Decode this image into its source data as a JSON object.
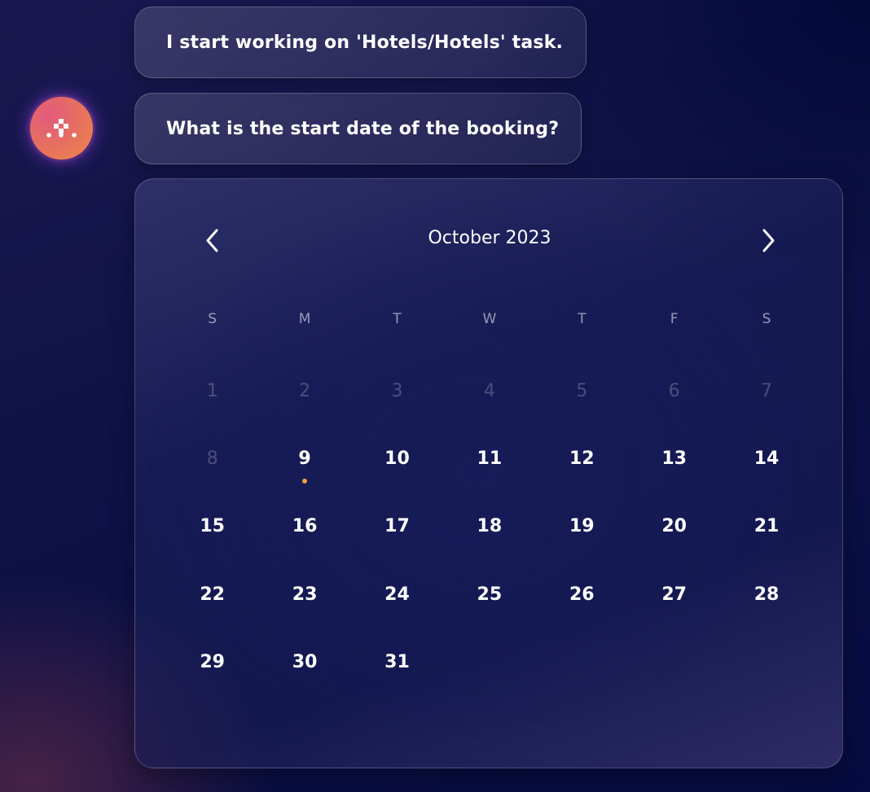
{
  "messages": [
    {
      "text": "I start working on 'Hotels/Hotels' task."
    },
    {
      "text": "What is the start date of the booking?"
    }
  ],
  "avatar": {
    "icon": "assistant-logo-icon",
    "colors": [
      "#e25a7d",
      "#ee8a48"
    ]
  },
  "calendar": {
    "month_label": "October 2023",
    "prev_icon": "chevron-left-icon",
    "next_icon": "chevron-right-icon",
    "weekdays": [
      "S",
      "M",
      "T",
      "W",
      "T",
      "F",
      "S"
    ],
    "today": 9,
    "today_marker_color": "#f0a040",
    "days": [
      {
        "label": "1",
        "enabled": false
      },
      {
        "label": "2",
        "enabled": false
      },
      {
        "label": "3",
        "enabled": false
      },
      {
        "label": "4",
        "enabled": false
      },
      {
        "label": "5",
        "enabled": false
      },
      {
        "label": "6",
        "enabled": false
      },
      {
        "label": "7",
        "enabled": false
      },
      {
        "label": "8",
        "enabled": false
      },
      {
        "label": "9",
        "enabled": true,
        "today": true
      },
      {
        "label": "10",
        "enabled": true
      },
      {
        "label": "11",
        "enabled": true
      },
      {
        "label": "12",
        "enabled": true
      },
      {
        "label": "13",
        "enabled": true
      },
      {
        "label": "14",
        "enabled": true
      },
      {
        "label": "15",
        "enabled": true
      },
      {
        "label": "16",
        "enabled": true
      },
      {
        "label": "17",
        "enabled": true
      },
      {
        "label": "18",
        "enabled": true
      },
      {
        "label": "19",
        "enabled": true
      },
      {
        "label": "20",
        "enabled": true
      },
      {
        "label": "21",
        "enabled": true
      },
      {
        "label": "22",
        "enabled": true
      },
      {
        "label": "23",
        "enabled": true
      },
      {
        "label": "24",
        "enabled": true
      },
      {
        "label": "25",
        "enabled": true
      },
      {
        "label": "26",
        "enabled": true
      },
      {
        "label": "27",
        "enabled": true
      },
      {
        "label": "28",
        "enabled": true
      },
      {
        "label": "29",
        "enabled": true
      },
      {
        "label": "30",
        "enabled": true
      },
      {
        "label": "31",
        "enabled": true
      }
    ]
  }
}
